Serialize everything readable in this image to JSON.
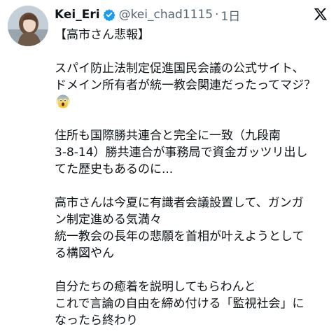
{
  "author": {
    "display_name": "Kei_Eri",
    "handle": "@kei_chad1115",
    "separator": "·",
    "time": "1日"
  },
  "icons": {
    "verified": "verified-badge-icon",
    "platform": "x-logo-icon",
    "emoji": "face-screaming-in-fear"
  },
  "colors": {
    "verified": "#1d9bf0",
    "text": "#0f1419",
    "secondary": "#536471"
  },
  "post": {
    "line1": "【高市さん悲報】",
    "line2": "スパイ防止法制定促進国民会議の公式サイト、\nドメイン所有者が統一教会関連だったってマジ？",
    "line3": "住所も国際勝共連合と完全に一致（九段南\n3-8-14）勝共連合が事務局で資金ガッツリ出し\nてた歴史もあるのに...",
    "line4": "高市さんは今夏に有識者会議設置して、ガンガ\nン制定進める気満々\n統一教会の長年の悲願を首相が叶えようとして\nる構図やん",
    "line5": "自分たちの癒着を説明してもらわんと\nこれで言論の自由を締め付ける「監視社会」に\nなったら終わり"
  }
}
